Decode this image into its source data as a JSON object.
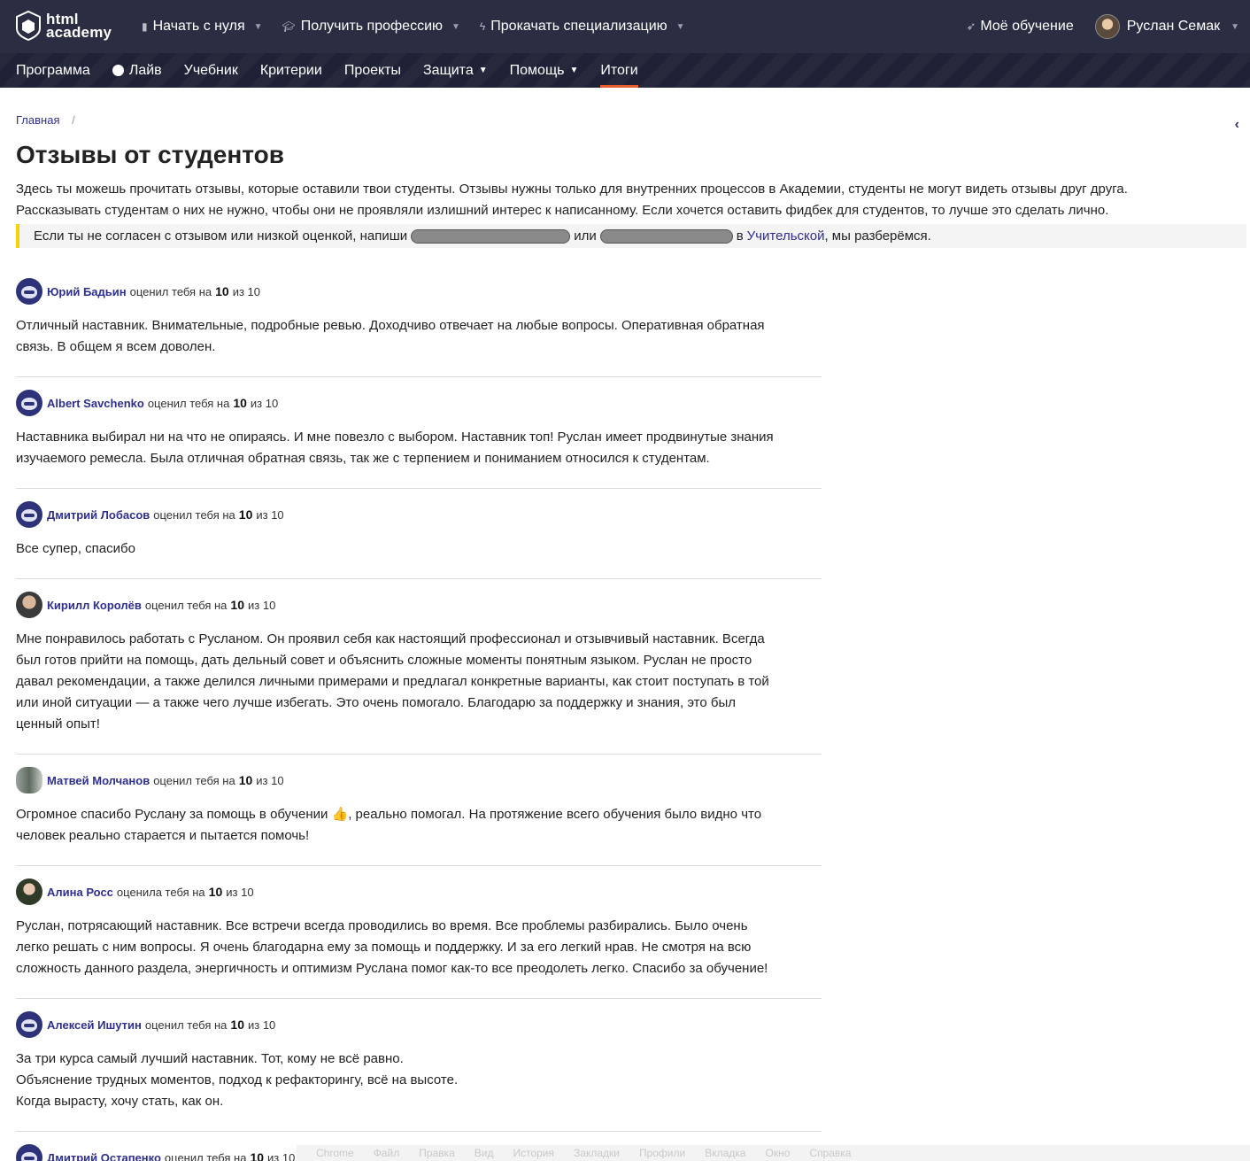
{
  "header": {
    "logo_text": "html\nacademy",
    "menu": [
      {
        "label": "Начать с нуля"
      },
      {
        "label": "Получить профессию"
      },
      {
        "label": "Прокачать специализацию"
      }
    ],
    "my_learning": "Моё обучение",
    "user_name": "Руслан Семак"
  },
  "subnav": {
    "items": [
      "Программа",
      "Лайв",
      "Учебник",
      "Критерии",
      "Проекты",
      "Защита",
      "Помощь",
      "Итоги"
    ],
    "active": "Итоги"
  },
  "breadcrumb": {
    "home": "Главная",
    "sep": "/"
  },
  "page": {
    "title": "Отзывы от студентов",
    "intro_line1": "Здесь ты можешь прочитать отзывы, которые оставили твои студенты. Отзывы нужны только для внутренних процессов в Академии, студенты не могут видеть отзывы друг друга.",
    "intro_line2": "Рассказывать студентам о них не нужно, чтобы они не проявляли излишний интерес к написанному. Если хочется оставить фидбек для студентов, то лучше это сделать лично.",
    "notice_start": "Если ты не согласен с отзывом или низкой оценкой, напиши",
    "notice_or": "или",
    "notice_in": "в",
    "notice_link": "Учительской",
    "notice_end": ", мы разберёмся."
  },
  "reviews": [
    {
      "name": "Юрий Бадьин",
      "verb": "оценил тебя на",
      "score": "10",
      "of": "из 10",
      "text": "Отличный наставник. Внимательные, подробные ревью. Доходчиво отвечает на любые вопросы. Оперативная обратная\nсвязь. В общем я всем доволен."
    },
    {
      "name": "Albert Savchenko",
      "verb": "оценил тебя на",
      "score": "10",
      "of": "из 10",
      "text": "Наставника выбирал ни на что не опираясь. И мне повезло с выбором. Наставник топ! Руслан имеет продвинутые знания\nизучаемого ремесла. Была отличная обратная связь, так же с терпением и пониманием относился к студентам."
    },
    {
      "name": "Дмитрий Лобасов",
      "verb": "оценил тебя на",
      "score": "10",
      "of": "из 10",
      "text": "Все супер, спасибо"
    },
    {
      "name": "Кирилл Королёв",
      "verb": "оценил тебя на",
      "score": "10",
      "of": "из 10",
      "text": "Мне понравилось работать с Русланом. Он проявил себя как настоящий профессионал и отзывчивый наставник. Всегда\nбыл готов прийти на помощь, дать дельный совет и объяснить сложные моменты понятным языком. Руслан не просто\nдавал рекомендации, а также делился личными примерами и предлагал конкретные варианты, как стоит поступать в той\nили иной ситуации — а также чего лучше избегать. Это очень помогало. Благодарю за поддержку и знания, это был\nценный опыт!"
    },
    {
      "name": "Матвей Молчанов",
      "verb": "оценил тебя на",
      "score": "10",
      "of": "из 10",
      "text": "Огромное спасибо Руслану за помощь в обучении 👍, реально помогал. На протяжение всего обучения было видно что\nчеловек реально старается и пытается помочь!"
    },
    {
      "name": "Алина Росс",
      "verb": "оценила тебя на",
      "score": "10",
      "of": "из 10",
      "text": "Руслан, потрясающий наставник. Все встречи всегда проводились во время. Все проблемы разбирались. Было очень\nлегко решать с ним вопросы. Я очень благодарна ему за помощь и поддержку. И за его легкий нрав. Не смотря на всю\nсложность данного раздела, энергичность и оптимизм Руслана помог как-то все преодолеть легко. Спасибо за обучение!"
    },
    {
      "name": "Алексей Ишутин",
      "verb": "оценил тебя на",
      "score": "10",
      "of": "из 10",
      "text": "За три курса самый лучший наставник. Тот, кому не всё равно.\nОбъяснение трудных моментов, подход к рефакторингу, всё на высоте.\nКогда вырасту, хочу стать, как он."
    },
    {
      "name": "Дмитрий Остапенко",
      "verb": "оценил тебя на",
      "score": "10",
      "of": "из 10",
      "text": ""
    }
  ],
  "bottom_bar": [
    "Chrome",
    "Файл",
    "Правка",
    "Вид",
    "История",
    "Закладки",
    "Профили",
    "Вкладка",
    "Окно",
    "Справка"
  ]
}
